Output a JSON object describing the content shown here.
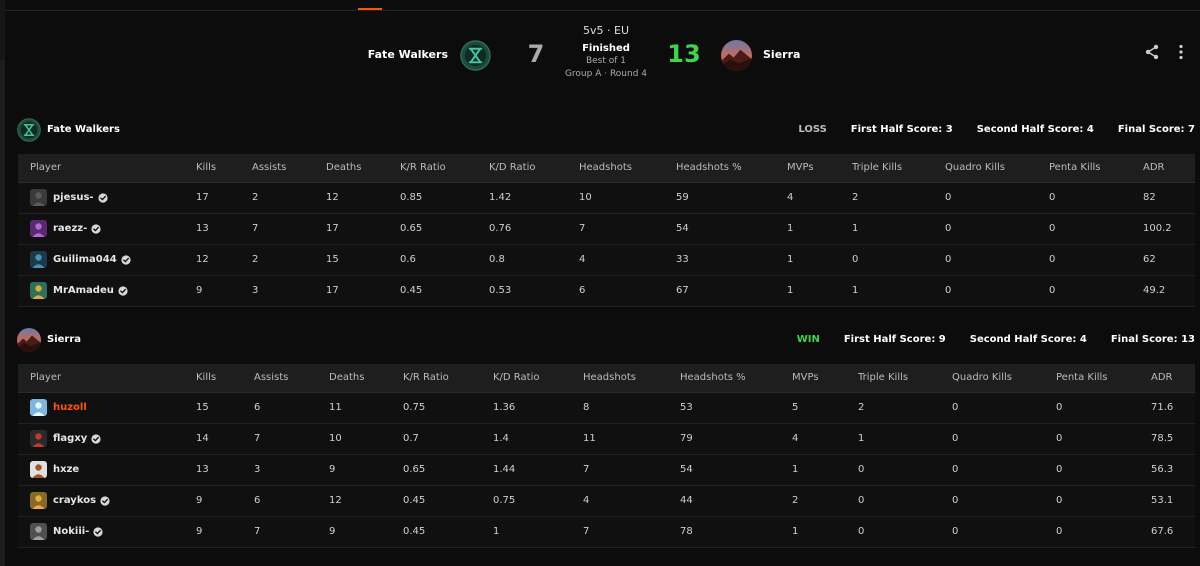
{
  "match": {
    "mode": "5v5 · EU",
    "status": "Finished",
    "best_of": "Best of 1",
    "group_round": "Group A · Round 4",
    "score_left": "7",
    "score_right": "13",
    "team_left": "Fate Walkers",
    "team_right": "Sierra",
    "actions": {
      "share_icon": "share-icon",
      "more_icon": "kebab-icon"
    }
  },
  "colors": {
    "accent": "#ff5500",
    "win": "#3dd64a",
    "score_loss": "#aaaaaa",
    "fw_logo": "#1d4a3e",
    "fw_logo_mark": "#45c59b"
  },
  "columns": [
    "Player",
    "Kills",
    "Assists",
    "Deaths",
    "K/R Ratio",
    "K/D Ratio",
    "Headshots",
    "Headshots %",
    "MVPs",
    "Triple Kills",
    "Quadro Kills",
    "Penta Kills",
    "ADR"
  ],
  "teams": [
    {
      "name": "Fate Walkers",
      "result": "LOSS",
      "first_half": "First Half Score: 3",
      "second_half": "Second Half Score: 4",
      "final": "Final Score: 7",
      "players": [
        {
          "name": "pjesus-",
          "verified": true,
          "stats": [
            "17",
            "2",
            "12",
            "0.85",
            "1.42",
            "10",
            "59",
            "4",
            "2",
            "0",
            "0",
            "82"
          ]
        },
        {
          "name": "raezz-",
          "verified": true,
          "stats": [
            "13",
            "7",
            "17",
            "0.65",
            "0.76",
            "7",
            "54",
            "1",
            "1",
            "0",
            "0",
            "100.2"
          ]
        },
        {
          "name": "Guilima044",
          "verified": true,
          "stats": [
            "12",
            "2",
            "15",
            "0.6",
            "0.8",
            "4",
            "33",
            "1",
            "0",
            "0",
            "0",
            "62"
          ]
        },
        {
          "name": "MrAmadeu",
          "verified": true,
          "stats": [
            "9",
            "3",
            "17",
            "0.45",
            "0.53",
            "6",
            "67",
            "1",
            "1",
            "0",
            "0",
            "49.2"
          ]
        }
      ]
    },
    {
      "name": "Sierra",
      "result": "WIN",
      "first_half": "First Half Score: 9",
      "second_half": "Second Half Score: 4",
      "final": "Final Score: 13",
      "players": [
        {
          "name": "huzoll",
          "verified": false,
          "highlight": true,
          "stats": [
            "15",
            "6",
            "11",
            "0.75",
            "1.36",
            "8",
            "53",
            "5",
            "2",
            "0",
            "0",
            "71.6"
          ]
        },
        {
          "name": "flagxy",
          "verified": true,
          "stats": [
            "14",
            "7",
            "10",
            "0.7",
            "1.4",
            "11",
            "79",
            "4",
            "1",
            "0",
            "0",
            "78.5"
          ]
        },
        {
          "name": "hxze",
          "verified": false,
          "stats": [
            "13",
            "3",
            "9",
            "0.65",
            "1.44",
            "7",
            "54",
            "1",
            "0",
            "0",
            "0",
            "56.3"
          ]
        },
        {
          "name": "craykos",
          "verified": true,
          "stats": [
            "9",
            "6",
            "12",
            "0.45",
            "0.75",
            "4",
            "44",
            "2",
            "0",
            "0",
            "0",
            "53.1"
          ]
        },
        {
          "name": "Nokiii-",
          "verified": true,
          "stats": [
            "9",
            "7",
            "9",
            "0.45",
            "1",
            "7",
            "78",
            "1",
            "0",
            "0",
            "0",
            "67.6"
          ]
        }
      ]
    }
  ]
}
